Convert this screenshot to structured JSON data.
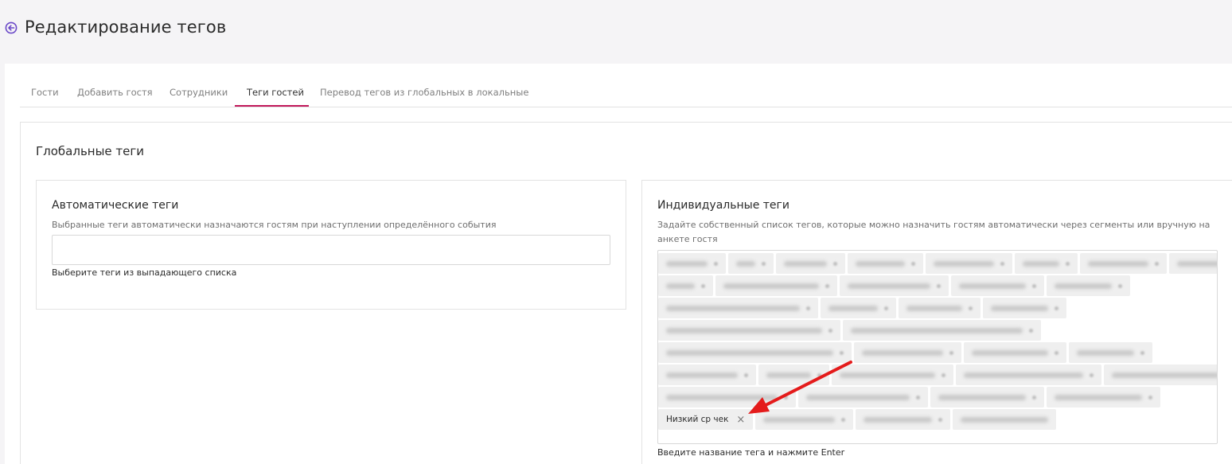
{
  "page": {
    "title": "Редактирование тегов"
  },
  "tabs": [
    {
      "label": "Гости"
    },
    {
      "label": "Добавить гостя"
    },
    {
      "label": "Сотрудники"
    },
    {
      "label": "Теги гостей"
    },
    {
      "label": "Перевод тегов из глобальных в локальные"
    }
  ],
  "active_tab": "Теги гостей",
  "accent_color": "#c2185b",
  "global_tags": {
    "title": "Глобальные теги",
    "auto": {
      "title": "Автоматические теги",
      "description": "Выбранные теги автоматически назначаются гостям при наступлении определённого события",
      "input_value": "",
      "hint": "Выберите теги из выпадающего списка"
    },
    "individual": {
      "title": "Индивидуальные теги",
      "description_line1": "Задайте собственный список тегов, которые можно назначить гостям автоматически через сегменты или вручную на",
      "description_line2": "анкете гостя",
      "visible_tag": "Низкий ср чек",
      "remove_icon": "×",
      "hint": "Введите название тега и нажмите Enter"
    }
  },
  "annotation": {
    "arrow_color": "#e41b1b"
  }
}
